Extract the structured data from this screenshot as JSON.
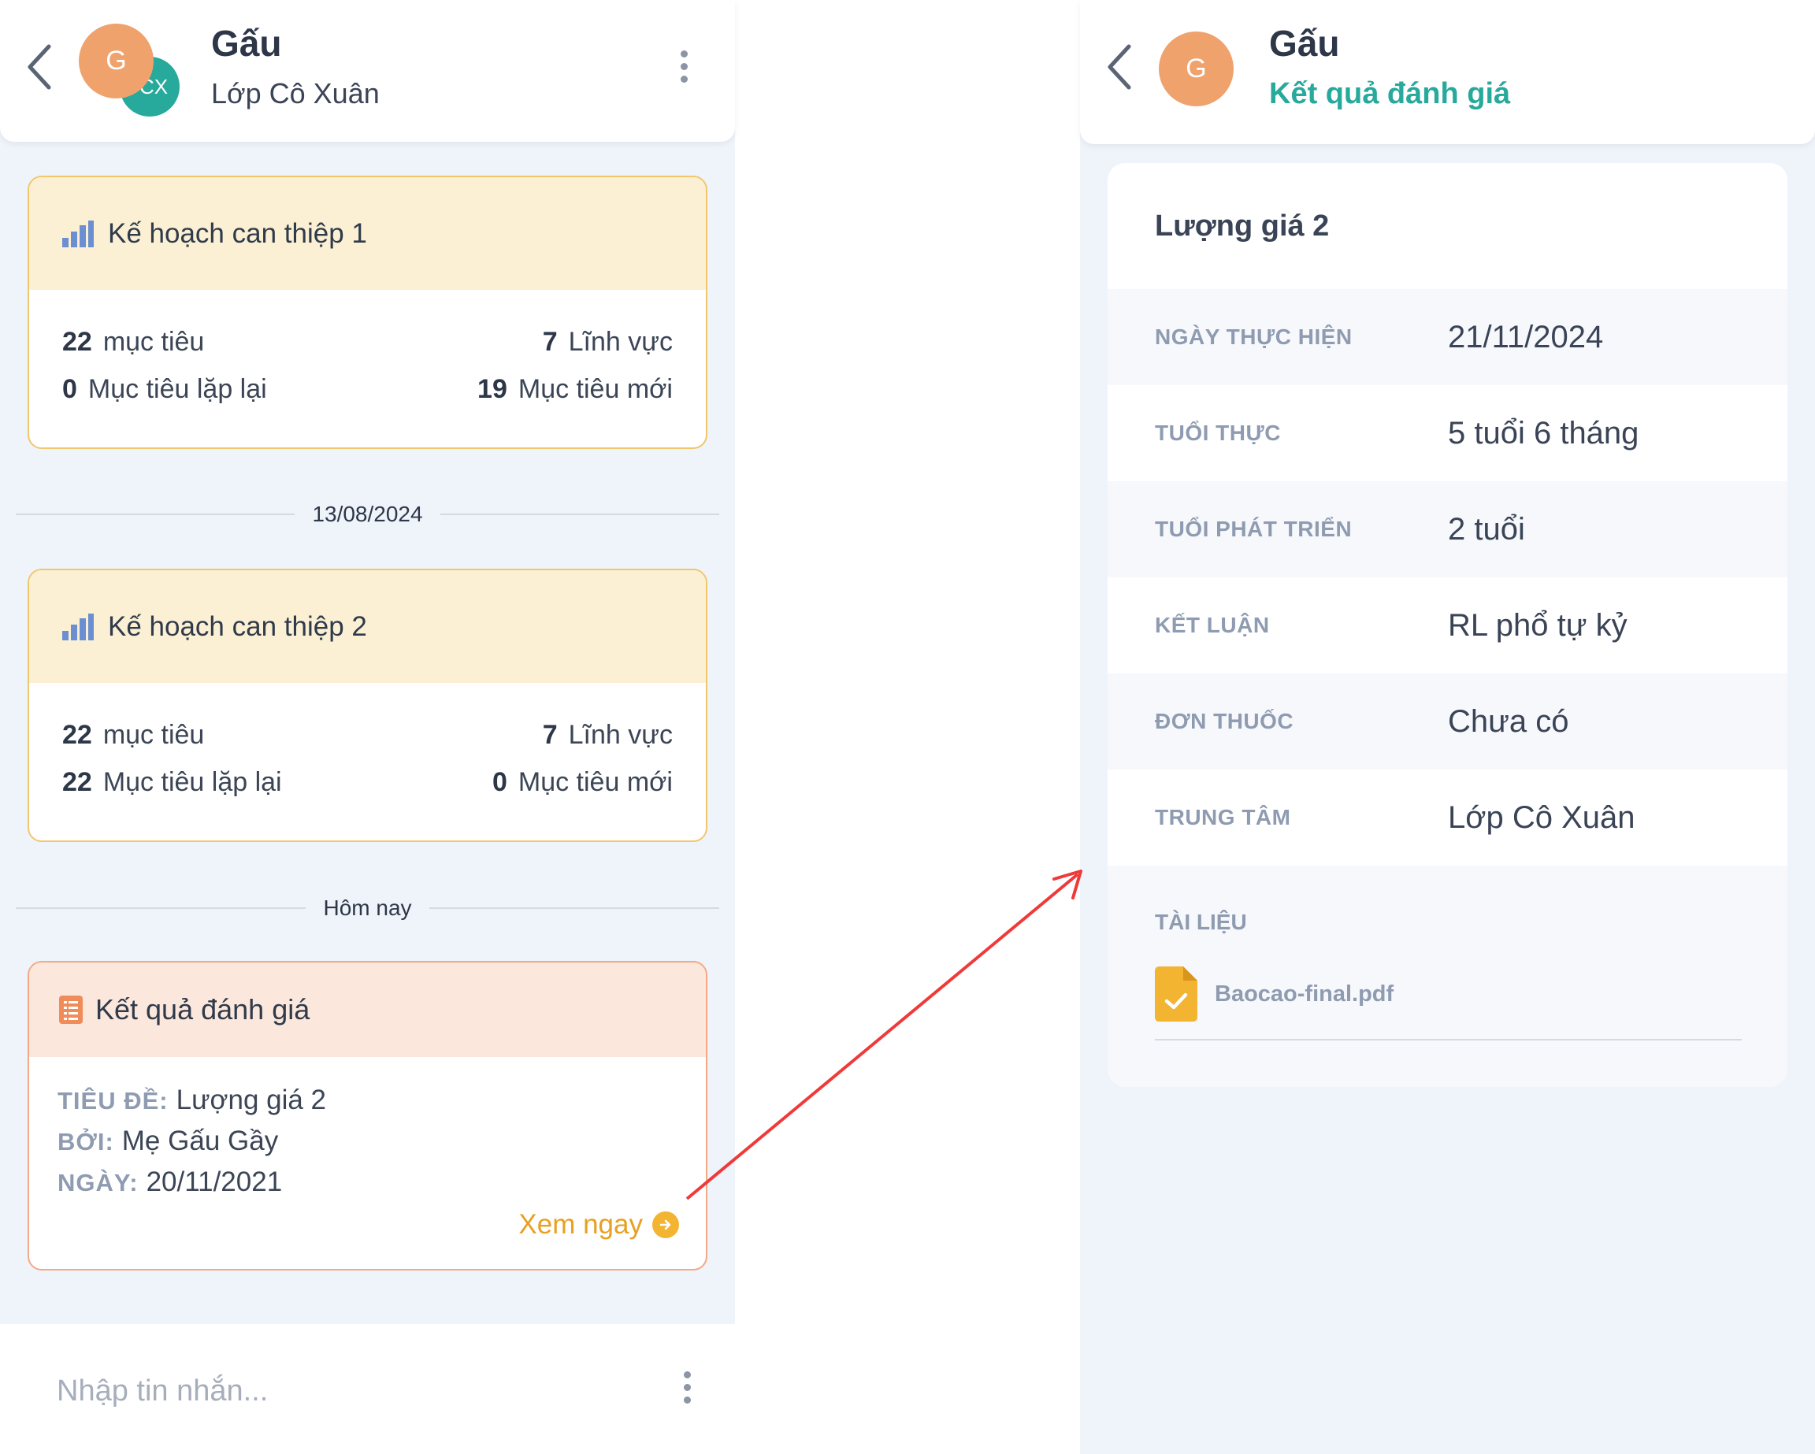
{
  "left": {
    "header": {
      "avatar_letter": "G",
      "sub_avatar_letters": "CX",
      "name": "Gấu",
      "subtitle": "Lớp Cô Xuân"
    },
    "plans": [
      {
        "title": "Kế hoạch can thiệp 1",
        "goals_count": "22",
        "goals_label": "mục tiêu",
        "areas_count": "7",
        "areas_label": "Lĩnh vực",
        "repeat_count": "0",
        "repeat_label": "Mục tiêu lặp lại",
        "new_count": "19",
        "new_label": "Mục tiêu mới"
      },
      {
        "title": "Kế hoạch can thiệp 2",
        "goals_count": "22",
        "goals_label": "mục tiêu",
        "areas_count": "7",
        "areas_label": "Lĩnh vực",
        "repeat_count": "22",
        "repeat_label": "Mục tiêu lặp lại",
        "new_count": "0",
        "new_label": "Mục tiêu mới"
      }
    ],
    "date_divider": "13/08/2024",
    "today_divider": "Hôm nay",
    "eval_card": {
      "title": "Kết quả đánh giá",
      "title_label": "TIÊU ĐỀ:",
      "title_value": "Lượng giá 2",
      "by_label": "BỞI:",
      "by_value": "Mẹ Gấu Gầy",
      "date_label": "NGÀY:",
      "date_value": "20/11/2021",
      "view_link": "Xem ngay"
    },
    "compose": {
      "placeholder": "Nhập tin nhắn..."
    }
  },
  "right": {
    "header": {
      "avatar_letter": "G",
      "name": "Gấu",
      "subtitle": "Kết quả đánh giá"
    },
    "detail": {
      "title": "Lượng giá 2",
      "rows": [
        {
          "label": "NGÀY THỰC HIỆN",
          "value": "21/11/2024"
        },
        {
          "label": "TUỔI THỰC",
          "value": "5 tuổi 6 tháng"
        },
        {
          "label": "TUỔI PHÁT TRIỂN",
          "value": "2 tuổi"
        },
        {
          "label": "KẾT LUẬN",
          "value": "RL phổ tự kỷ"
        },
        {
          "label": "ĐƠN THUỐC",
          "value": "Chưa có"
        },
        {
          "label": "TRUNG TÂM",
          "value": "Lớp Cô Xuân"
        }
      ],
      "docs_label": "TÀI LIỆU",
      "file_name": "Baocao-final.pdf"
    }
  },
  "colors": {
    "accent_green": "#27a99b",
    "accent_orange": "#e8a023",
    "avatar_orange": "#f0a26c",
    "annotation_arrow": "#f03a3a"
  }
}
